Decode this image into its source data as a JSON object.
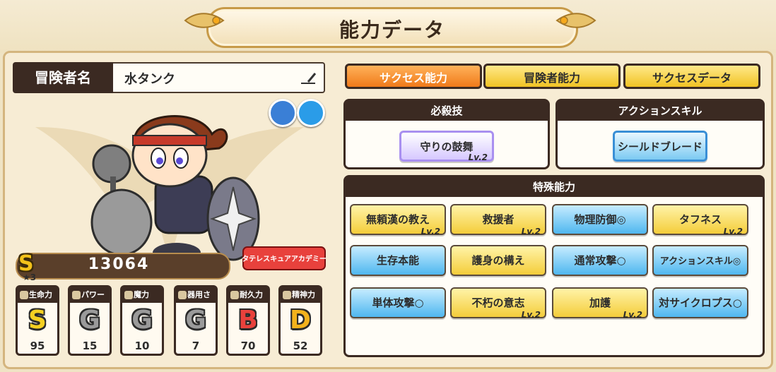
{
  "header": {
    "title": "能力データ"
  },
  "character": {
    "name_label": "冒険者名",
    "name": "水タンク",
    "score_rank": "S",
    "stars": "★3",
    "score": "13064",
    "badge_text": "タテレスキュアアカデミー"
  },
  "stats": [
    {
      "label": "生命力",
      "grade": "S",
      "value": "95",
      "color": "#f5d021"
    },
    {
      "label": "パワー",
      "grade": "G",
      "value": "15",
      "color": "#9a9a9a"
    },
    {
      "label": "魔力",
      "grade": "G",
      "value": "10",
      "color": "#9a9a9a"
    },
    {
      "label": "器用さ",
      "grade": "G",
      "value": "7",
      "color": "#9a9a9a"
    },
    {
      "label": "耐久力",
      "grade": "B",
      "value": "70",
      "color": "#e8413c"
    },
    {
      "label": "精神力",
      "grade": "D",
      "value": "52",
      "color": "#f3b21c"
    }
  ],
  "tabs": [
    {
      "label": "サクセス能力",
      "active": true
    },
    {
      "label": "冒険者能力",
      "active": false
    },
    {
      "label": "サクセスデータ",
      "active": false
    }
  ],
  "special_move": {
    "header": "必殺技",
    "skill": "守りの鼓舞",
    "level": "Lv.2"
  },
  "action_skill": {
    "header": "アクションスキル",
    "skill": "シールドブレード"
  },
  "special_abilities": {
    "header": "特殊能力",
    "items": [
      {
        "label": "無頼漢の教え",
        "style": "gold",
        "level": "Lv.2"
      },
      {
        "label": "救援者",
        "style": "gold",
        "level": "Lv.2"
      },
      {
        "label": "物理防御◎",
        "style": "blue",
        "level": ""
      },
      {
        "label": "タフネス",
        "style": "gold",
        "level": "Lv.2"
      },
      {
        "label": "生存本能",
        "style": "blue",
        "level": ""
      },
      {
        "label": "護身の構え",
        "style": "gold",
        "level": ""
      },
      {
        "label": "通常攻撃○",
        "style": "blue",
        "level": ""
      },
      {
        "label": "アクションスキル◎",
        "style": "blue",
        "level": ""
      },
      {
        "label": "単体攻撃○",
        "style": "blue",
        "level": ""
      },
      {
        "label": "不朽の意志",
        "style": "gold",
        "level": "Lv.2"
      },
      {
        "label": "加護",
        "style": "gold",
        "level": "Lv.2"
      },
      {
        "label": "対サイクロプス○",
        "style": "blue",
        "level": ""
      }
    ]
  },
  "colors": {
    "accent_orange": "#f07a1a",
    "gold": "#f4cd3a",
    "blue": "#4fb7ef",
    "dark": "#3b2a22"
  },
  "icons": {
    "element_1": "wind-icon",
    "element_2": "water-icon",
    "edit": "pen-icon"
  }
}
